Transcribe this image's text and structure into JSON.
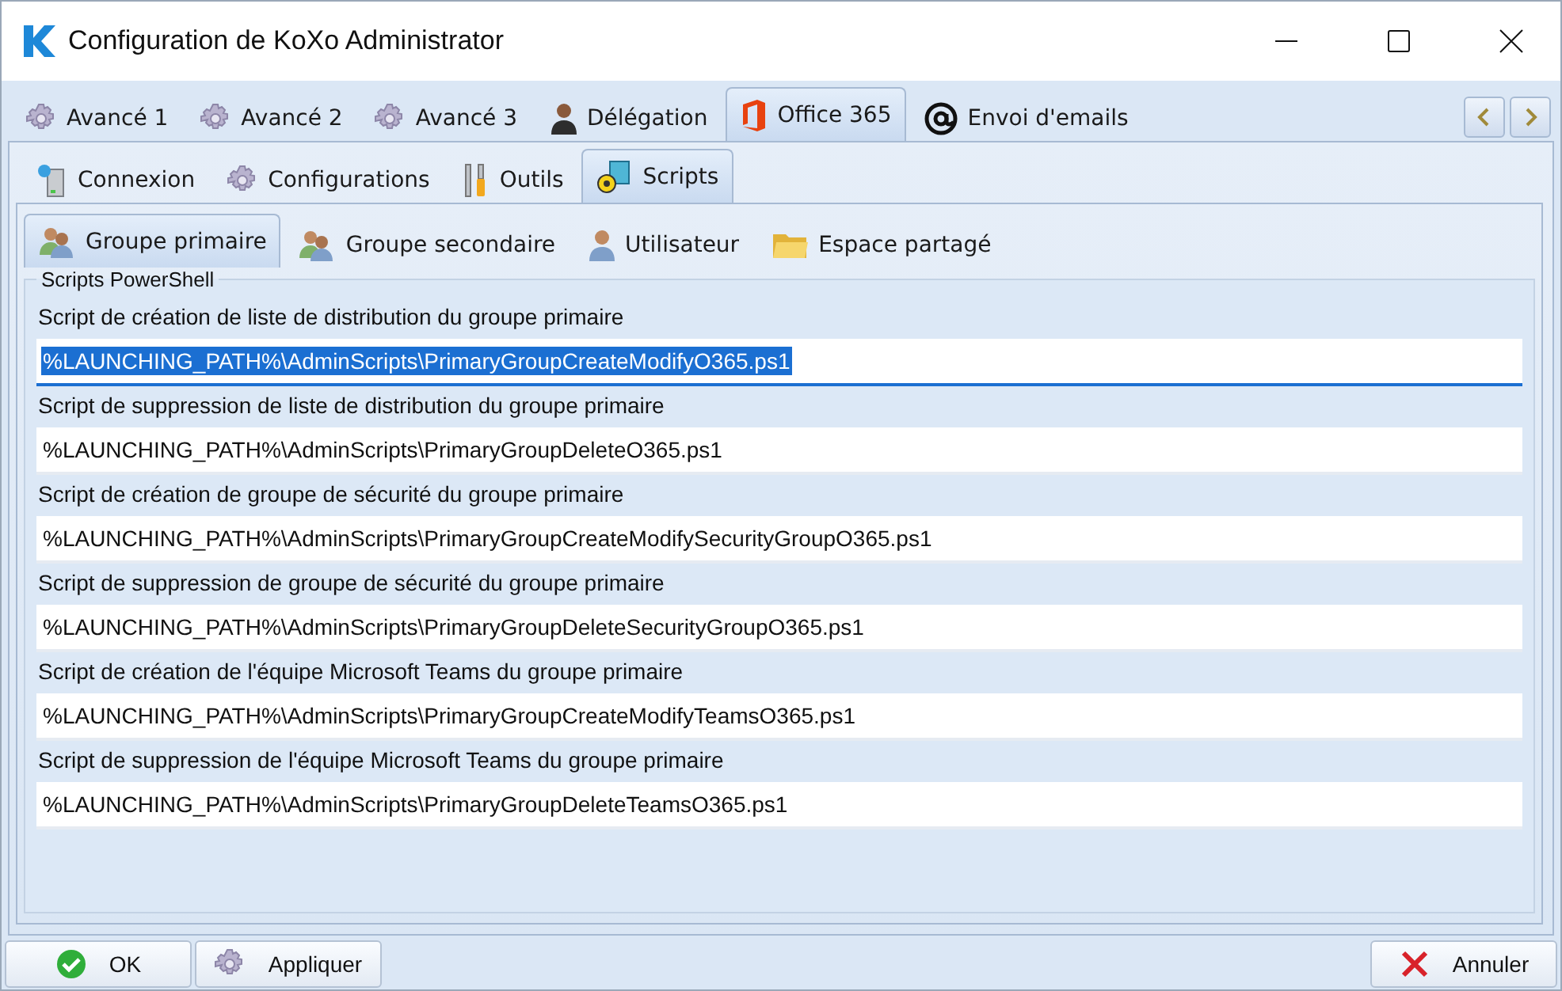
{
  "window": {
    "title": "Configuration de KoXo Administrator"
  },
  "main_tabs": [
    {
      "label": "Avancé 1",
      "selected": false
    },
    {
      "label": "Avancé 2",
      "selected": false
    },
    {
      "label": "Avancé 3",
      "selected": false
    },
    {
      "label": "Délégation",
      "selected": false
    },
    {
      "label": "Office 365",
      "selected": true
    },
    {
      "label": "Envoi d'emails",
      "selected": false
    }
  ],
  "sub_tabs": [
    {
      "label": "Connexion",
      "selected": false
    },
    {
      "label": "Configurations",
      "selected": false
    },
    {
      "label": "Outils",
      "selected": false
    },
    {
      "label": "Scripts",
      "selected": true
    }
  ],
  "script_tabs": [
    {
      "label": "Groupe primaire",
      "selected": true
    },
    {
      "label": "Groupe secondaire",
      "selected": false
    },
    {
      "label": "Utilisateur",
      "selected": false
    },
    {
      "label": "Espace partagé",
      "selected": false
    }
  ],
  "group": {
    "title": "Scripts PowerShell",
    "fields": [
      {
        "label": "Script de création de liste de distribution du groupe primaire",
        "value": "%LAUNCHING_PATH%\\AdminScripts\\PrimaryGroupCreateModifyO365.ps1",
        "focused": true
      },
      {
        "label": "Script de suppression de liste de distribution du groupe primaire",
        "value": "%LAUNCHING_PATH%\\AdminScripts\\PrimaryGroupDeleteO365.ps1",
        "focused": false
      },
      {
        "label": "Script de création de groupe de sécurité du groupe primaire",
        "value": "%LAUNCHING_PATH%\\AdminScripts\\PrimaryGroupCreateModifySecurityGroupO365.ps1",
        "focused": false
      },
      {
        "label": "Script de suppression de groupe de sécurité du groupe primaire",
        "value": "%LAUNCHING_PATH%\\AdminScripts\\PrimaryGroupDeleteSecurityGroupO365.ps1",
        "focused": false
      },
      {
        "label": "Script de création de l'équipe Microsoft Teams du groupe primaire",
        "value": "%LAUNCHING_PATH%\\AdminScripts\\PrimaryGroupCreateModifyTeamsO365.ps1",
        "focused": false
      },
      {
        "label": "Script de suppression de l'équipe Microsoft Teams du groupe primaire",
        "value": "%LAUNCHING_PATH%\\AdminScripts\\PrimaryGroupDeleteTeamsO365.ps1",
        "focused": false
      }
    ]
  },
  "buttons": {
    "ok": "OK",
    "apply": "Appliquer",
    "cancel": "Annuler"
  }
}
